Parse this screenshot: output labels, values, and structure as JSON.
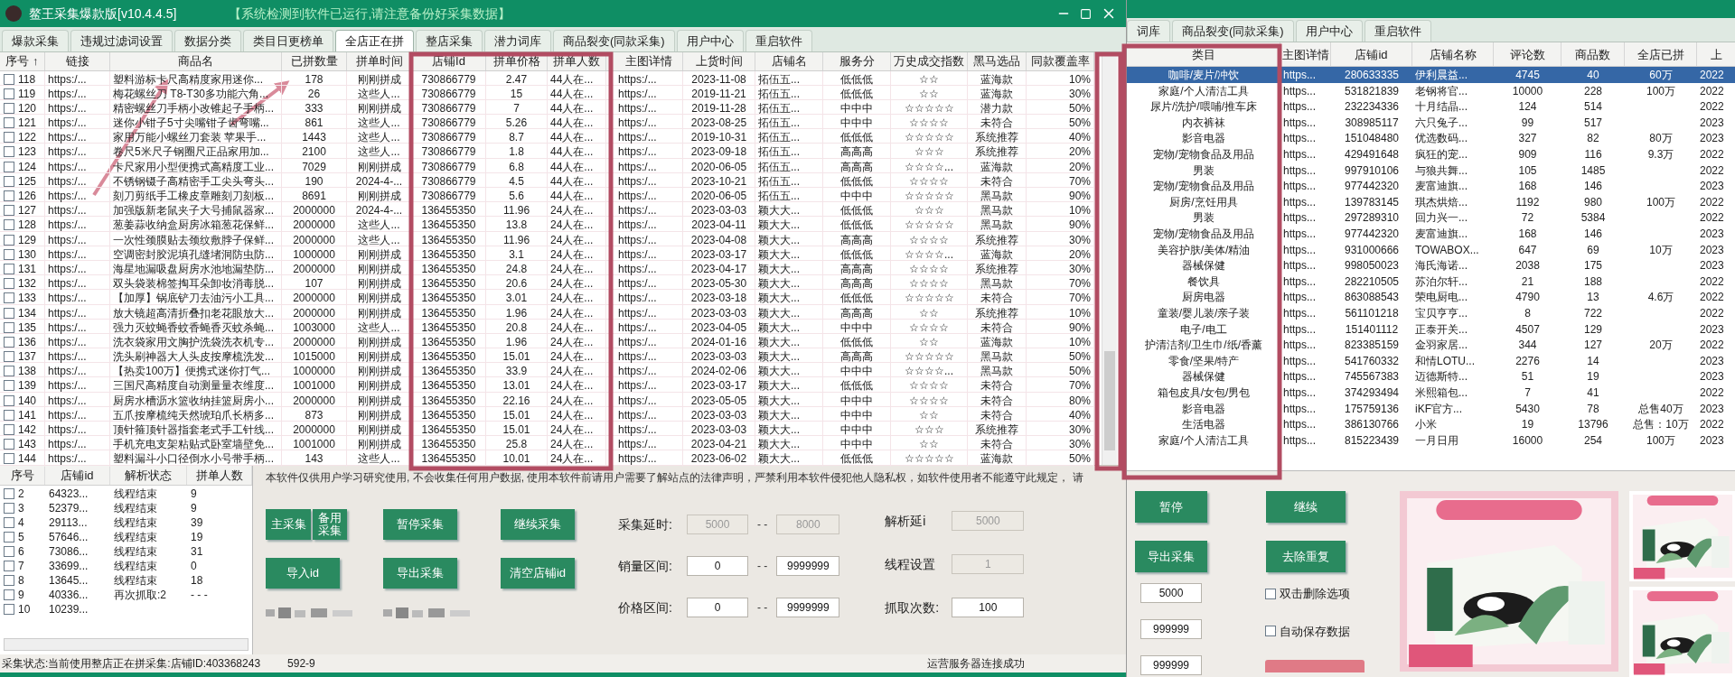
{
  "window": {
    "title": "鳌王采集爆款版[v10.4.4.5]",
    "notice": "【系统检测到软件已运行,请注意备份好采集数据】"
  },
  "tabs": [
    {
      "label": "爆款采集",
      "selected": false
    },
    {
      "label": "违规过滤词设置",
      "selected": false
    },
    {
      "label": "数据分类",
      "selected": false
    },
    {
      "label": "类目日更榜单",
      "selected": false
    },
    {
      "label": "全店正在拼",
      "selected": true
    },
    {
      "label": "整店采集",
      "selected": false
    },
    {
      "label": "潜力词库",
      "selected": false
    },
    {
      "label": "商品裂变(同款采集)",
      "selected": false
    },
    {
      "label": "用户中心",
      "selected": false
    },
    {
      "label": "重启软件",
      "selected": false
    }
  ],
  "table": {
    "columns": [
      "序号 ↑",
      "链接",
      "商品名",
      "已拼数量",
      "拼单时间",
      "店铺Id",
      "拼单价格",
      "拼单人数",
      "主图详情",
      "上货时间",
      "店铺名",
      "服务分",
      "万史成交指数",
      "黑马选品",
      "同款覆盖率"
    ],
    "rows": [
      {
        "checked": false,
        "cells": [
          "118",
          "https:/...",
          "塑料游标卡尺高精度家用迷你...",
          "178",
          "刚刚拼成",
          "730866779",
          "2.47",
          "44人在...",
          "https:/...",
          "2023-11-08",
          "拓伍五...",
          "低低低",
          "☆☆",
          "蓝海款",
          "10%"
        ]
      },
      {
        "checked": false,
        "cells": [
          "119",
          "https:/...",
          "梅花螺丝刀 T8-T30多功能六角...",
          "26",
          "这些人...",
          "730866779",
          "15",
          "44人在...",
          "https:/...",
          "2019-11-21",
          "拓伍五...",
          "低低低",
          "☆☆",
          "蓝海款",
          "30%"
        ]
      },
      {
        "checked": false,
        "cells": [
          "120",
          "https:/...",
          "精密螺丝刀手柄小改锥起子手柄...",
          "333",
          "刚刚拼成",
          "730866779",
          "7",
          "44人在...",
          "https:/...",
          "2019-11-28",
          "拓伍五...",
          "中中中",
          "☆☆☆☆☆",
          "潜力款",
          "50%"
        ]
      },
      {
        "checked": false,
        "cells": [
          "121",
          "https:/...",
          "迷你小钳子5寸尖嘴钳子齿弯嘴...",
          "861",
          "这些人...",
          "730866779",
          "5.26",
          "44人在...",
          "https:/...",
          "2023-08-25",
          "拓伍五...",
          "中中中",
          "☆☆☆☆",
          "未符合",
          "50%"
        ]
      },
      {
        "checked": false,
        "cells": [
          "122",
          "https:/...",
          "家用万能小螺丝刀套装 苹果手...",
          "1443",
          "这些人...",
          "730866779",
          "8.7",
          "44人在...",
          "https:/...",
          "2019-10-31",
          "拓伍五...",
          "低低低",
          "☆☆☆☆☆",
          "系统推荐",
          "40%"
        ]
      },
      {
        "checked": false,
        "cells": [
          "123",
          "https:/...",
          "卷尺5米尺子钢圈尺正品家用加...",
          "2100",
          "这些人...",
          "730866779",
          "1.8",
          "44人在...",
          "https:/...",
          "2023-09-18",
          "拓伍五...",
          "高高高",
          "☆☆☆",
          "系统推荐",
          "20%"
        ]
      },
      {
        "checked": false,
        "cells": [
          "124",
          "https:/...",
          "卡尺家用小型便携式高精度工业...",
          "7029",
          "刚刚拼成",
          "730866779",
          "6.8",
          "44人在...",
          "https:/...",
          "2020-06-05",
          "拓伍五...",
          "高高高",
          "☆☆☆☆...",
          "蓝海款",
          "20%"
        ]
      },
      {
        "checked": false,
        "cells": [
          "125",
          "https:/...",
          "不锈钢镊子高精密手工尖头弯头...",
          "190",
          "2024-4-...",
          "730866779",
          "4.5",
          "44人在...",
          "https:/...",
          "2023-10-21",
          "拓伍五...",
          "低低低",
          "☆☆☆☆",
          "未符合",
          "70%"
        ]
      },
      {
        "checked": false,
        "cells": [
          "126",
          "https:/...",
          "刻刀剪纸手工橡皮章雕刻刀刻板...",
          "8691",
          "刚刚拼成",
          "730866779",
          "5.6",
          "44人在...",
          "https:/...",
          "2020-06-05",
          "拓伍五...",
          "中中中",
          "☆☆☆☆☆",
          "黑马款",
          "90%"
        ]
      },
      {
        "checked": false,
        "cells": [
          "127",
          "https:/...",
          "加强版新老鼠夹子大号捕鼠器家...",
          "2000000",
          "2024-4-...",
          "136455350",
          "11.96",
          "24人在...",
          "https:/...",
          "2023-03-03",
          "颖大大...",
          "低低低",
          "☆☆☆",
          "黑马款",
          "10%"
        ]
      },
      {
        "checked": false,
        "cells": [
          "128",
          "https:/...",
          "葱姜蒜收纳盒厨房冰箱葱花保鲜...",
          "2000000",
          "这些人...",
          "136455350",
          "13.8",
          "24人在...",
          "https:/...",
          "2023-04-11",
          "颖大大...",
          "低低低",
          "☆☆☆☆☆",
          "黑马款",
          "90%"
        ]
      },
      {
        "checked": false,
        "cells": [
          "129",
          "https:/...",
          "一次性颈膜贴去颈纹敷脖子保鲜...",
          "2000000",
          "这些人...",
          "136455350",
          "11.96",
          "24人在...",
          "https:/...",
          "2023-04-08",
          "颖大大...",
          "高高高",
          "☆☆☆☆",
          "系统推荐",
          "30%"
        ]
      },
      {
        "checked": false,
        "cells": [
          "130",
          "https:/...",
          "空调密封胶泥填孔缝堵洞防虫防...",
          "1000000",
          "刚刚拼成",
          "136455350",
          "3.1",
          "24人在...",
          "https:/...",
          "2023-03-17",
          "颖大大...",
          "低低低",
          "☆☆☆☆...",
          "蓝海款",
          "20%"
        ]
      },
      {
        "checked": false,
        "cells": [
          "131",
          "https:/...",
          "海星地漏吸盘厨房水池地漏垫防...",
          "2000000",
          "刚刚拼成",
          "136455350",
          "24.8",
          "24人在...",
          "https:/...",
          "2023-04-17",
          "颖大大...",
          "高高高",
          "☆☆☆☆",
          "系统推荐",
          "30%"
        ]
      },
      {
        "checked": false,
        "cells": [
          "132",
          "https:/...",
          "双头袋装棉签掏耳朵卸妆消毒脱...",
          "107",
          "刚刚拼成",
          "136455350",
          "20.6",
          "24人在...",
          "https:/...",
          "2023-05-30",
          "颖大大...",
          "高高高",
          "☆☆☆☆",
          "黑马款",
          "70%"
        ]
      },
      {
        "checked": false,
        "cells": [
          "133",
          "https:/...",
          "【加厚】锅底铲刀去油污小工具...",
          "2000000",
          "刚刚拼成",
          "136455350",
          "3.01",
          "24人在...",
          "https:/...",
          "2023-03-18",
          "颖大大...",
          "低低低",
          "☆☆☆☆☆",
          "未符合",
          "70%"
        ]
      },
      {
        "checked": false,
        "cells": [
          "134",
          "https:/...",
          "放大镜超高清折叠扣老花眼放大...",
          "2000000",
          "刚刚拼成",
          "136455350",
          "1.96",
          "24人在...",
          "https:/...",
          "2023-03-03",
          "颖大大...",
          "高高高",
          "☆☆",
          "系统推荐",
          "10%"
        ]
      },
      {
        "checked": false,
        "cells": [
          "135",
          "https:/...",
          "强力灭蚊蝇香蚊香蝇香灭蚊杀蝇...",
          "1003000",
          "这些人...",
          "136455350",
          "20.8",
          "24人在...",
          "https:/...",
          "2023-04-05",
          "颖大大...",
          "中中中",
          "☆☆☆☆",
          "未符合",
          "90%"
        ]
      },
      {
        "checked": false,
        "cells": [
          "136",
          "https:/...",
          "洗衣袋家用文胸护洗袋洗衣机专...",
          "2000000",
          "刚刚拼成",
          "136455350",
          "1.96",
          "24人在...",
          "https:/...",
          "2024-01-16",
          "颖大大...",
          "低低低",
          "☆☆",
          "蓝海款",
          "10%"
        ]
      },
      {
        "checked": false,
        "cells": [
          "137",
          "https:/...",
          "洗头刷神器大人头皮按摩梳洗发...",
          "1015000",
          "刚刚拼成",
          "136455350",
          "15.01",
          "24人在...",
          "https:/...",
          "2023-03-03",
          "颖大大...",
          "高高高",
          "☆☆☆☆☆",
          "黑马款",
          "50%"
        ]
      },
      {
        "checked": false,
        "cells": [
          "138",
          "https:/...",
          "【热卖100万】便携式迷你打气...",
          "1000000",
          "刚刚拼成",
          "136455350",
          "33.9",
          "24人在...",
          "https:/...",
          "2024-02-06",
          "颖大大...",
          "中中中",
          "☆☆☆☆...",
          "黑马款",
          "50%"
        ]
      },
      {
        "checked": false,
        "cells": [
          "139",
          "https:/...",
          "三国尺高精度自动测量量衣维度...",
          "1001000",
          "刚刚拼成",
          "136455350",
          "13.01",
          "24人在...",
          "https:/...",
          "2023-03-17",
          "颖大大...",
          "低低低",
          "☆☆☆☆",
          "未符合",
          "70%"
        ]
      },
      {
        "checked": false,
        "cells": [
          "140",
          "https:/...",
          "厨房水槽沥水篮收纳挂篮厨房小...",
          "2000000",
          "刚刚拼成",
          "136455350",
          "22.16",
          "24人在...",
          "https:/...",
          "2023-05-05",
          "颖大大...",
          "中中中",
          "☆☆☆☆",
          "未符合",
          "80%"
        ]
      },
      {
        "checked": false,
        "cells": [
          "141",
          "https:/...",
          "五爪按摩梳纯天然琥珀爪长柄多...",
          "873",
          "刚刚拼成",
          "136455350",
          "15.01",
          "24人在...",
          "https:/...",
          "2023-03-03",
          "颖大大...",
          "中中中",
          "☆☆",
          "未符合",
          "40%"
        ]
      },
      {
        "checked": false,
        "cells": [
          "142",
          "https:/...",
          "顶针箍顶针器指套老式手工针线...",
          "2000000",
          "刚刚拼成",
          "136455350",
          "15.01",
          "24人在...",
          "https:/...",
          "2023-03-03",
          "颖大大...",
          "中中中",
          "☆☆☆",
          "系统推荐",
          "30%"
        ]
      },
      {
        "checked": false,
        "cells": [
          "143",
          "https:/...",
          "手机充电支架粘贴式卧室墙壁免...",
          "1001000",
          "刚刚拼成",
          "136455350",
          "25.8",
          "24人在...",
          "https:/...",
          "2023-04-21",
          "颖大大...",
          "中中中",
          "☆☆",
          "未符合",
          "30%"
        ]
      },
      {
        "checked": false,
        "cells": [
          "144",
          "https:/...",
          "塑料漏斗小口径倒水小号带手柄...",
          "143",
          "这些人...",
          "136455350",
          "10.01",
          "24人在...",
          "https:/...",
          "2023-06-02",
          "颖大大...",
          "低低低",
          "☆☆☆☆☆",
          "蓝海款",
          "50%"
        ]
      }
    ]
  },
  "thread_table": {
    "columns": [
      "序号",
      "店铺id",
      "解析状态",
      "拼单人数"
    ],
    "rows": [
      {
        "checked": false,
        "cells": [
          "2",
          "64323...",
          "线程结束",
          "9"
        ]
      },
      {
        "checked": false,
        "cells": [
          "3",
          "52379...",
          "线程结束",
          "9"
        ]
      },
      {
        "checked": false,
        "cells": [
          "4",
          "29113...",
          "线程结束",
          "39"
        ]
      },
      {
        "checked": false,
        "cells": [
          "5",
          "57646...",
          "线程结束",
          "19"
        ]
      },
      {
        "checked": false,
        "cells": [
          "6",
          "73086...",
          "线程结束",
          "31"
        ]
      },
      {
        "checked": false,
        "cells": [
          "7",
          "33699...",
          "线程结束",
          "0"
        ]
      },
      {
        "checked": false,
        "cells": [
          "8",
          "13645...",
          "线程结束",
          "18"
        ]
      },
      {
        "checked": false,
        "cells": [
          "9",
          "40336...",
          "再次抓取:2",
          "- - -"
        ]
      },
      {
        "checked": false,
        "cells": [
          "10",
          "10239..."
        ]
      }
    ]
  },
  "disclaimer": "本软件仅供用户学习研究使用, 不会收集任何用户数据, 使用本软件前请用户需要了解站点的法律声明，严禁利用本软件侵犯他人隐私权，如软件使用者不能遵守此规定， 请",
  "buttons": [
    "主采集",
    "备用采集",
    "暂停采集",
    "继续采集",
    "导入id",
    "导出采集",
    "清空店铺id"
  ],
  "range_fields": [
    {
      "label": "采集延时:",
      "from": "5000",
      "separator": "- -",
      "to": "8000",
      "disabled": true
    },
    {
      "label": "销量区间:",
      "from": "0",
      "separator": "- -",
      "to": "9999999",
      "disabled": false
    },
    {
      "label": "价格区间:",
      "from": "0",
      "separator": "- -",
      "to": "9999999",
      "disabled": false
    }
  ],
  "settings": [
    {
      "label": "解析延i",
      "value": "5000",
      "disabled": true
    },
    {
      "label": "线程设置",
      "value": "1",
      "disabled": true
    },
    {
      "label": "抓取次数:",
      "value": "100",
      "disabled": false
    }
  ],
  "status_bar": {
    "status": "采集状态:当前使用整店正在拼采集:店铺ID:403368243",
    "code": "592-9",
    "server": "运营服务器连接成功"
  },
  "right_window": {
    "tabs": [
      {
        "label": "词库",
        "selected": false
      },
      {
        "label": "商品裂变(同款采集)",
        "selected": false
      },
      {
        "label": "用户中心",
        "selected": false
      },
      {
        "label": "重启软件",
        "selected": false
      }
    ],
    "table": {
      "columns": [
        "类目",
        "主图详情",
        "店铺id",
        "店铺名称",
        "评论数",
        "商品数",
        "全店已拼",
        "上"
      ],
      "rows": [
        {
          "selected": true,
          "category": "咖啡/麦片/冲饮",
          "link": "https...",
          "shop_id": "280633335",
          "shop_name": "伊利晨益...",
          "reviews": "4745",
          "products": "40",
          "total": "60万",
          "column_8": "2022"
        },
        {
          "selected": false,
          "category": "家庭/个人清洁工具",
          "link": "https...",
          "shop_id": "531821839",
          "shop_name": "老钢将官...",
          "reviews": "10000",
          "products": "228",
          "total": "100万",
          "column_8": "2022"
        },
        {
          "selected": false,
          "category": "尿片/洗护/喂哺/推车床",
          "link": "https...",
          "shop_id": "232234336",
          "shop_name": "十月结晶...",
          "reviews": "124",
          "products": "514",
          "column_8": "2022"
        },
        {
          "selected": false,
          "category": "内衣裤袜",
          "link": "https...",
          "shop_id": "308985117",
          "shop_name": "六只兔子...",
          "reviews": "99",
          "products": "517",
          "column_8": "2023"
        },
        {
          "selected": false,
          "category": "影音电器",
          "link": "https...",
          "shop_id": "151048480",
          "shop_name": "优选数码...",
          "reviews": "327",
          "products": "82",
          "total": "80万",
          "column_8": "2023"
        },
        {
          "selected": false,
          "category": "宠物/宠物食品及用品",
          "link": "https...",
          "shop_id": "429491648",
          "shop_name": "疯狂的宠...",
          "reviews": "909",
          "products": "116",
          "total": "9.3万",
          "column_8": "2022"
        },
        {
          "selected": false,
          "category": "男装",
          "link": "https...",
          "shop_id": "997910106",
          "shop_name": "与狼共舞...",
          "reviews": "105",
          "products": "1485",
          "column_8": "2022"
        },
        {
          "selected": false,
          "category": "宠物/宠物食品及用品",
          "link": "https...",
          "shop_id": "977442320",
          "shop_name": "麦富迪旗...",
          "reviews": "168",
          "products": "146",
          "column_8": "2023"
        },
        {
          "selected": false,
          "category": "厨房/烹饪用具",
          "link": "https...",
          "shop_id": "139783145",
          "shop_name": "琪杰烘焙...",
          "reviews": "1192",
          "products": "980",
          "total": "100万",
          "column_8": "2022"
        },
        {
          "selected": false,
          "category": "男装",
          "link": "https...",
          "shop_id": "297289310",
          "shop_name": "回力兴一...",
          "reviews": "72",
          "products": "5384",
          "column_8": "2022"
        },
        {
          "selected": false,
          "category": "宠物/宠物食品及用品",
          "link": "https...",
          "shop_id": "977442320",
          "shop_name": "麦富迪旗...",
          "reviews": "168",
          "products": "146",
          "column_8": "2023"
        },
        {
          "selected": false,
          "category": "美容护肤/美体/精油",
          "link": "https...",
          "shop_id": "931000666",
          "shop_name": "TOWABOX...",
          "reviews": "647",
          "products": "69",
          "total": "10万",
          "column_8": "2023"
        },
        {
          "selected": false,
          "category": "器械保健",
          "link": "https...",
          "shop_id": "998050023",
          "shop_name": "海氏海诺...",
          "reviews": "2038",
          "products": "175",
          "column_8": "2023"
        },
        {
          "selected": false,
          "category": "餐饮具",
          "link": "https...",
          "shop_id": "282210505",
          "shop_name": "苏泊尔轩...",
          "reviews": "21",
          "products": "188",
          "column_8": "2022"
        },
        {
          "selected": false,
          "category": "厨房电器",
          "link": "https...",
          "shop_id": "863088543",
          "shop_name": "荣电厨电...",
          "reviews": "4790",
          "products": "13",
          "total": "4.6万",
          "column_8": "2022"
        },
        {
          "selected": false,
          "category": "童装/婴儿装/亲子装",
          "link": "https...",
          "shop_id": "561101218",
          "shop_name": "宝贝亨亨...",
          "reviews": "8",
          "products": "722",
          "column_8": "2022"
        },
        {
          "selected": false,
          "category": "电子/电工",
          "link": "https...",
          "shop_id": "151401112",
          "shop_name": "正泰开关...",
          "reviews": "4507",
          "products": "129",
          "column_8": "2023"
        },
        {
          "selected": false,
          "category": "护清洁剂/卫生巾/纸/香薰",
          "link": "https...",
          "shop_id": "823385159",
          "shop_name": "金羽家居...",
          "reviews": "344",
          "products": "127",
          "total": "20万",
          "column_8": "2022"
        },
        {
          "selected": false,
          "category": "零食/坚果/特产",
          "link": "https...",
          "shop_id": "541760332",
          "shop_name": "和情LOTU...",
          "reviews": "2276",
          "products": "14",
          "column_8": "2023"
        },
        {
          "selected": false,
          "category": "器械保健",
          "link": "https...",
          "shop_id": "745567383",
          "shop_name": "迈德斯特...",
          "reviews": "51",
          "products": "19",
          "column_8": "2023"
        },
        {
          "selected": false,
          "category": "箱包皮具/女包/男包",
          "link": "https...",
          "shop_id": "374293494",
          "shop_name": "米熙箱包...",
          "reviews": "7",
          "products": "41",
          "column_8": "2022"
        },
        {
          "selected": false,
          "category": "影音电器",
          "link": "https...",
          "shop_id": "175759136",
          "shop_name": "iKF官方...",
          "reviews": "5430",
          "products": "78",
          "total": "总售40万",
          "column_8": "2023"
        },
        {
          "selected": false,
          "category": "生活电器",
          "link": "https...",
          "shop_id": "386130766",
          "shop_name": "小米",
          "reviews": "19",
          "products": "13796",
          "total": "总售：10万",
          "column_8": "2022"
        },
        {
          "selected": false,
          "category": "家庭/个人清洁工具",
          "link": "https...",
          "shop_id": "815223439",
          "shop_name": "一月日用",
          "reviews": "16000",
          "products": "254",
          "total": "100万",
          "column_8": "2023"
        }
      ]
    },
    "buttons": [
      "暂停",
      "继续",
      "导出采集",
      "去除重复"
    ],
    "fields": [
      "5000",
      "999999",
      "999999"
    ],
    "options": [
      {
        "label": "双击删除选项",
        "checked": false
      },
      {
        "label": "自动保存数据",
        "checked": false
      }
    ]
  }
}
